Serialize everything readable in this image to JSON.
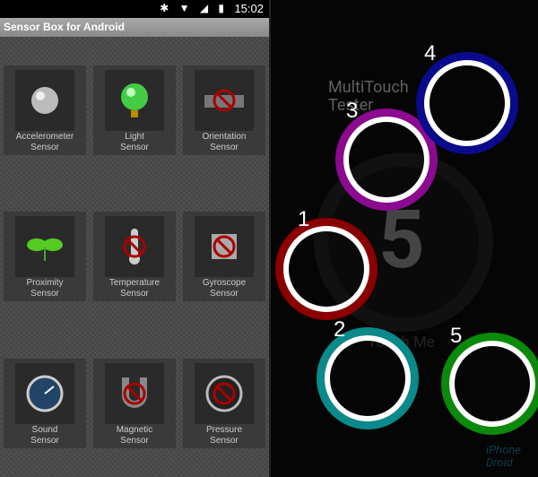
{
  "status_bar": {
    "icons": [
      "bluetooth-icon",
      "wifi-icon",
      "signal-icon",
      "battery-icon"
    ],
    "time": "15:02"
  },
  "left_app": {
    "title": "Sensor Box for Android",
    "sensors": [
      {
        "line1": "Accelerometer",
        "line2": "Sensor",
        "icon": "ball-icon",
        "disabled": false
      },
      {
        "line1": "Light",
        "line2": "Sensor",
        "icon": "green-orb-icon",
        "disabled": false
      },
      {
        "line1": "Orientation",
        "line2": "Sensor",
        "icon": "level-icon",
        "disabled": true
      },
      {
        "line1": "Proximity",
        "line2": "Sensor",
        "icon": "sprout-icon",
        "disabled": false
      },
      {
        "line1": "Temperature",
        "line2": "Sensor",
        "icon": "thermometer-icon",
        "disabled": true
      },
      {
        "line1": "Gyroscope",
        "line2": "Sensor",
        "icon": "cube-icon",
        "disabled": true
      },
      {
        "line1": "Sound",
        "line2": "Sensor",
        "icon": "gauge-icon",
        "disabled": false
      },
      {
        "line1": "Magnetic",
        "line2": "Sensor",
        "icon": "magnet-icon",
        "disabled": true
      },
      {
        "line1": "Pressure",
        "line2": "Sensor",
        "icon": "barometer-icon",
        "disabled": true
      }
    ]
  },
  "right_app": {
    "logo": "MultiTouch Tester",
    "touch_count": "5",
    "touch_me": "Touch Me",
    "watermark": "iPhone Droid",
    "touches": [
      {
        "label": "1",
        "color": "#8b0000"
      },
      {
        "label": "2",
        "color": "#0a8a8a"
      },
      {
        "label": "3",
        "color": "#8b0a90"
      },
      {
        "label": "4",
        "color": "#0a0a8c"
      },
      {
        "label": "5",
        "color": "#0a8a0a"
      }
    ]
  }
}
